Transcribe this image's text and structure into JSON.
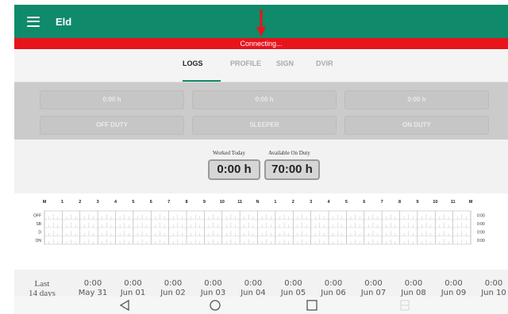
{
  "appbar": {
    "title": "Eld",
    "menu_icon": "menu-icon",
    "arrow_icon": "arrow-down-icon",
    "accent": "#0f8a6a"
  },
  "connection": {
    "text": "Connecting...",
    "color": "#e8141c"
  },
  "tabs": [
    {
      "label": "LOGS",
      "active": true
    },
    {
      "label": "PROFILE",
      "active": false
    },
    {
      "label": "SIGN",
      "active": false
    },
    {
      "label": "DVIR",
      "active": false
    }
  ],
  "status_boxes": [
    {
      "time": "0:00 h",
      "label": "OFF DUTY"
    },
    {
      "time": "0:00 h",
      "label": "SLEEPER"
    },
    {
      "time": "0:00 h",
      "label": "ON DUTY"
    }
  ],
  "summary": {
    "worked_label": "Worked Today",
    "worked_value": "0:00 h",
    "available_label": "Available On Duty",
    "available_value": "70:00 h"
  },
  "log_chart": {
    "hour_labels": [
      "M",
      "1",
      "2",
      "3",
      "4",
      "5",
      "6",
      "7",
      "8",
      "9",
      "10",
      "11",
      "N",
      "1",
      "2",
      "3",
      "4",
      "5",
      "6",
      "7",
      "8",
      "9",
      "10",
      "11",
      "M"
    ],
    "rows": [
      {
        "status": "OFF",
        "total": "0:00"
      },
      {
        "status": "SB",
        "total": "0:00"
      },
      {
        "status": "D",
        "total": "0:00"
      },
      {
        "status": "ON",
        "total": "0:00"
      }
    ]
  },
  "history": {
    "title": [
      "Last",
      "14 days"
    ],
    "days": [
      {
        "value": "0:00",
        "date": "May 31"
      },
      {
        "value": "0:00",
        "date": "Jun 01"
      },
      {
        "value": "0:00",
        "date": "Jun 02"
      },
      {
        "value": "0:00",
        "date": "Jun 03"
      },
      {
        "value": "0:00",
        "date": "Jun 04"
      },
      {
        "value": "0:00",
        "date": "Jun 05"
      },
      {
        "value": "0:00",
        "date": "Jun 06"
      },
      {
        "value": "0:00",
        "date": "Jun 07"
      },
      {
        "value": "0:00",
        "date": "Jun 08"
      },
      {
        "value": "0:00",
        "date": "Jun 09"
      },
      {
        "value": "0:00",
        "date": "Jun 10"
      }
    ]
  },
  "navbar": {
    "icons": [
      "back-icon",
      "home-icon",
      "recents-icon",
      "screenshot-icon"
    ]
  }
}
